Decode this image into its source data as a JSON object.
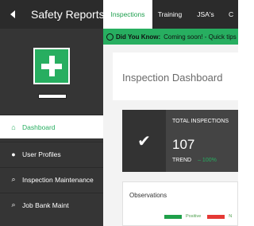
{
  "header": {
    "brand": "Safety Reports",
    "tabs": [
      {
        "label": "Inspections",
        "active": true
      },
      {
        "label": "Training",
        "active": false
      },
      {
        "label": "JSA's",
        "active": false
      },
      {
        "label": "C",
        "active": false
      }
    ]
  },
  "tip": {
    "bold": "Did You Know:",
    "text": "Coming soon! - Quick tips"
  },
  "sidebar": {
    "items": [
      {
        "label": "Dashboard",
        "icon": "home-icon",
        "active": true
      },
      {
        "label": "User Profiles",
        "icon": "user-icon",
        "active": false
      },
      {
        "label": "Inspection Maintenance",
        "icon": "search-icon",
        "active": false
      },
      {
        "label": "Job Bank Maint",
        "icon": "search-icon",
        "active": false
      }
    ]
  },
  "main": {
    "title": "Inspection Dashboard",
    "stat": {
      "label": "TOTAL INSPECTIONS",
      "value": "107",
      "trend_label": "TREND",
      "trend_value": "100%"
    },
    "observations": {
      "title": "Observations",
      "legend": [
        {
          "label": "Positive",
          "color": "#1fa04a"
        },
        {
          "label": "N",
          "color": "#e53935"
        }
      ]
    }
  },
  "colors": {
    "accent": "#27ae60",
    "sidebar_bg": "#353535",
    "header_bg": "#2b2b2b"
  }
}
